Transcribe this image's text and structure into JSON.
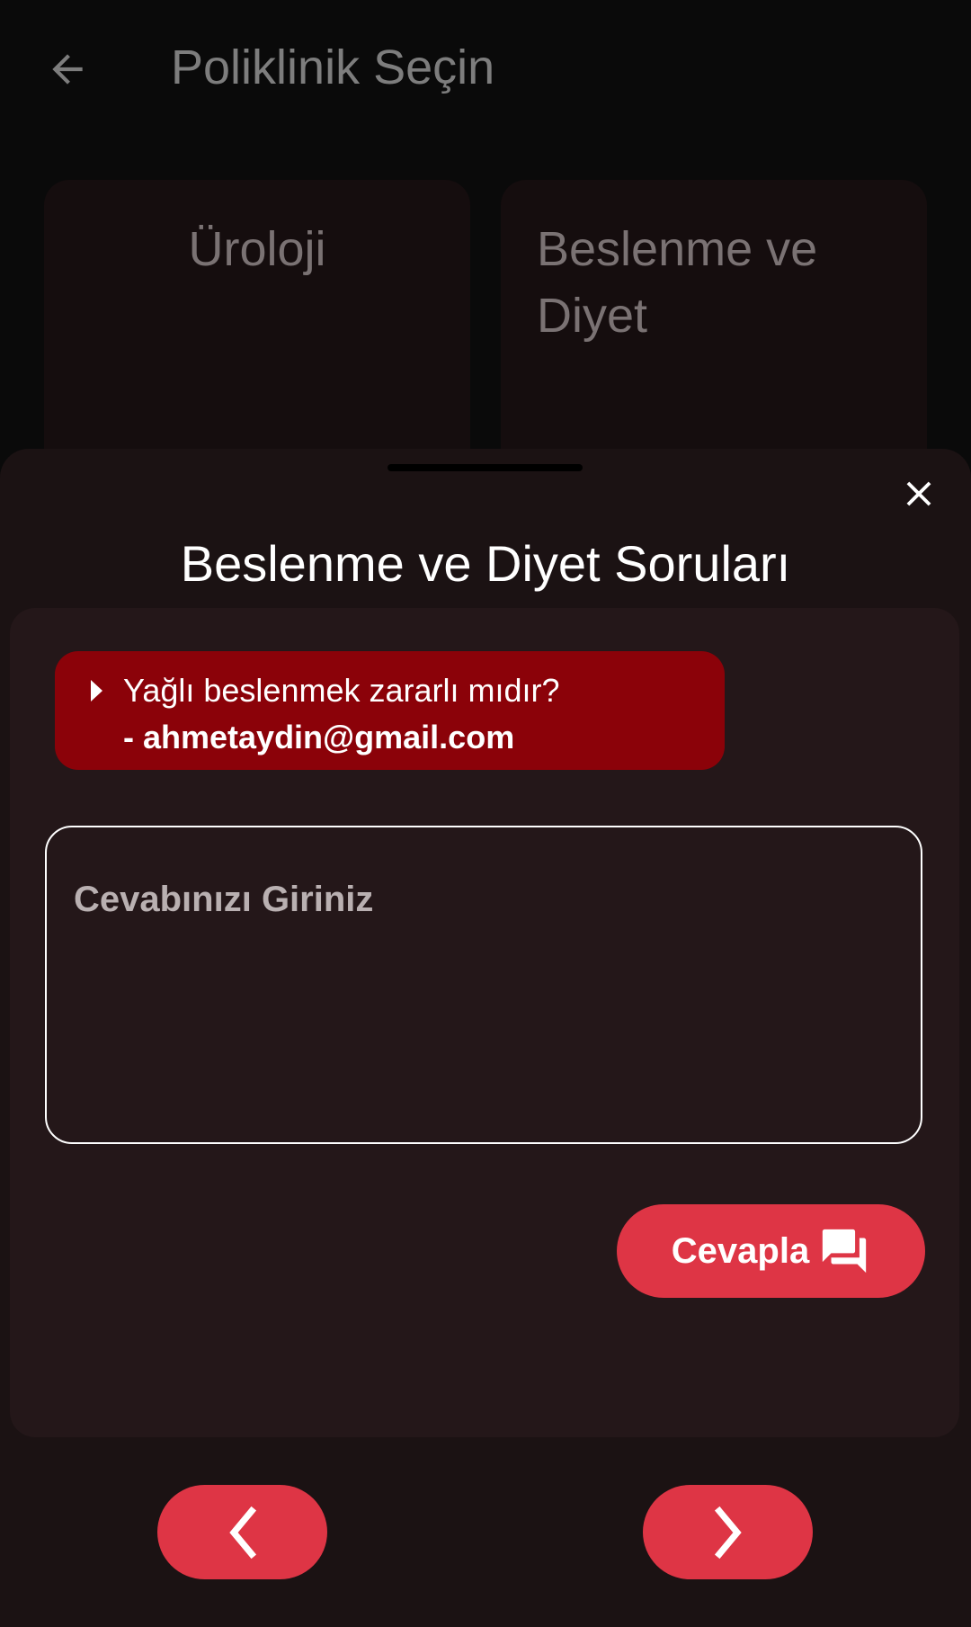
{
  "appbar": {
    "title": "Poliklinik Seçin",
    "back_icon": "arrow-left-icon"
  },
  "clinics": [
    {
      "label": "Üroloji"
    },
    {
      "label": "Beslenme ve Diyet"
    }
  ],
  "sheet": {
    "title": "Beslenme ve Diyet Soruları",
    "close_icon": "close-icon",
    "question": {
      "text": "Yağlı beslenmek zararlı mıdır?",
      "author": "- ahmetaydin@gmail.com"
    },
    "answer_input": {
      "placeholder": "Cevabınızı Giriniz",
      "value": ""
    },
    "answer_button": {
      "label": "Cevapla",
      "icon": "forum-icon"
    },
    "nav": {
      "prev_icon": "chevron-left-icon",
      "next_icon": "chevron-right-icon"
    }
  },
  "colors": {
    "accent": "#de3545",
    "question_chip": "#8b0209",
    "sheet_bg": "#1b1213",
    "panel_bg": "#241719"
  }
}
